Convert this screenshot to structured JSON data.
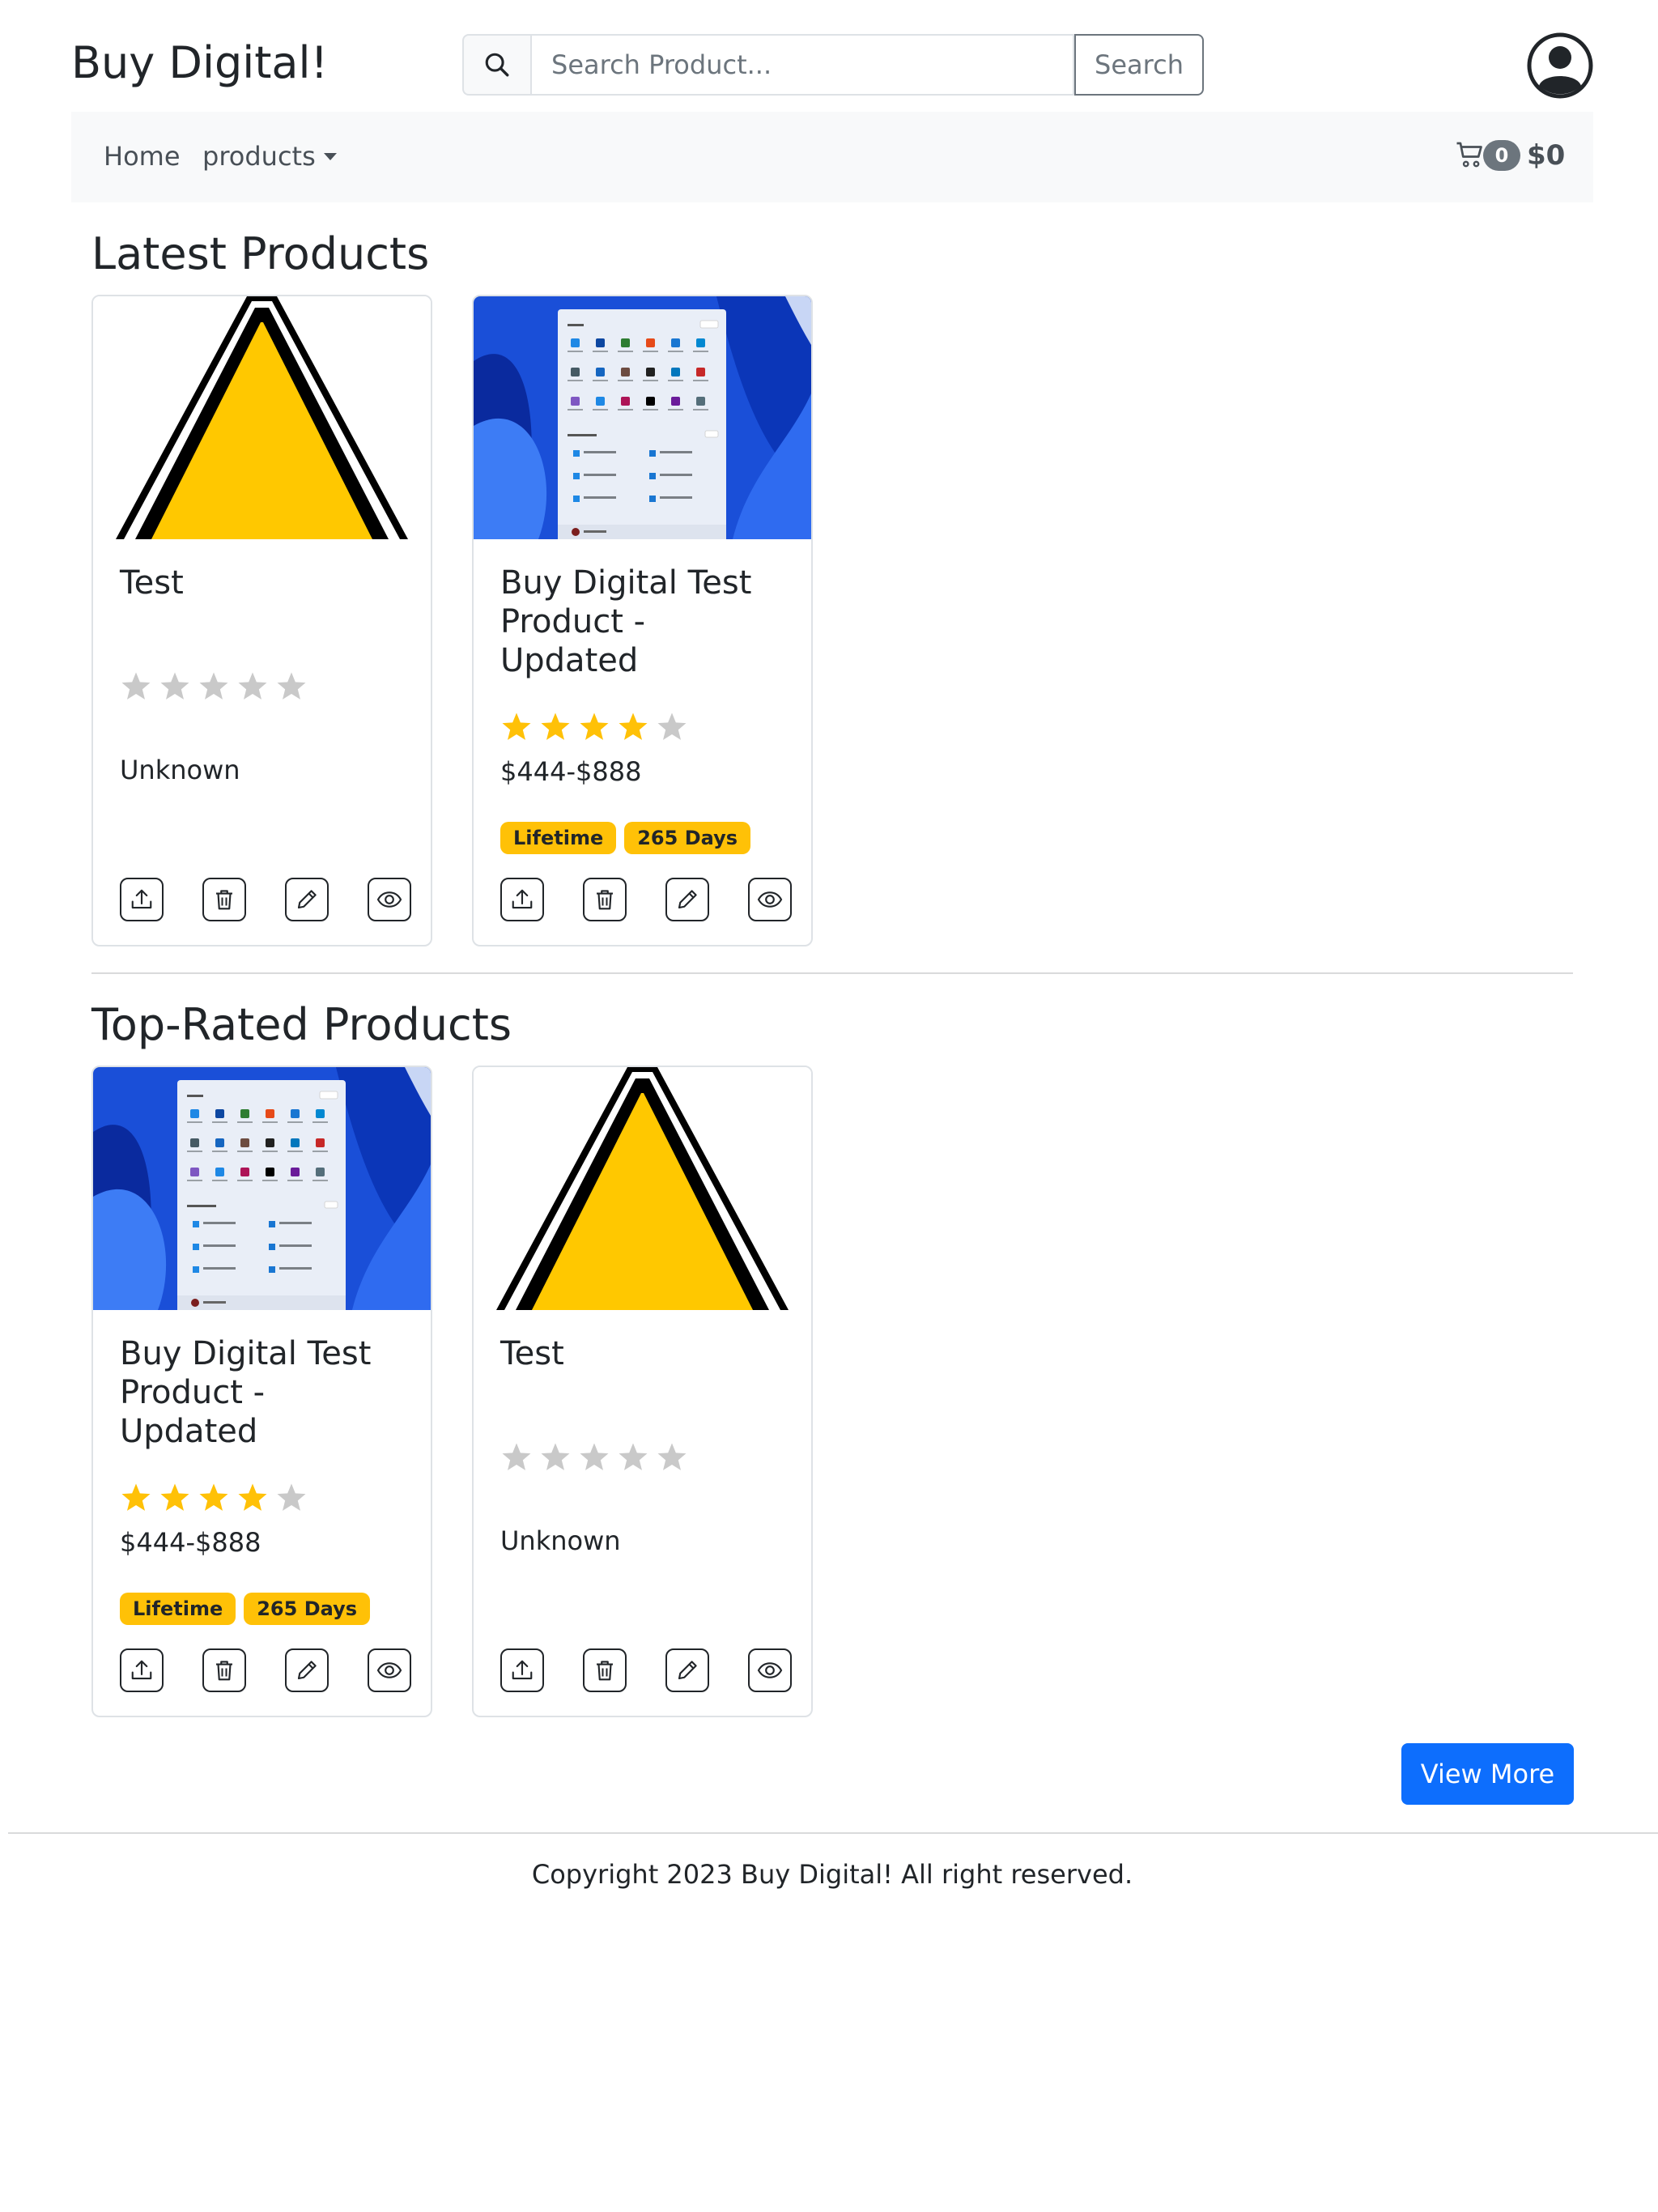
{
  "header": {
    "brand": "Buy Digital!",
    "search": {
      "placeholder": "Search Product...",
      "button_label": "Search"
    }
  },
  "navbar": {
    "home_label": "Home",
    "products_label": "products",
    "cart": {
      "count": "0",
      "total": "$0"
    }
  },
  "sections": [
    {
      "title": "Latest Products",
      "cards": [
        {
          "title": "Test",
          "image": "warning-triangle",
          "rating": 0,
          "price": "Unknown",
          "badges": []
        },
        {
          "title": "Buy Digital Test Product - Updated",
          "image": "windows-start-menu",
          "rating": 4,
          "price": "$444-$888",
          "badges": [
            "Lifetime",
            "265 Days"
          ]
        }
      ]
    },
    {
      "title": "Top-Rated Products",
      "cards": [
        {
          "title": "Buy Digital Test Product - Updated",
          "image": "windows-start-menu",
          "rating": 4,
          "price": "$444-$888",
          "badges": [
            "Lifetime",
            "265 Days"
          ]
        },
        {
          "title": "Test",
          "image": "warning-triangle",
          "rating": 0,
          "price": "Unknown",
          "badges": []
        }
      ]
    }
  ],
  "card_actions": [
    "upload-icon",
    "trash-icon",
    "pencil-icon",
    "eye-icon"
  ],
  "colors": {
    "star_filled": "#ffc107",
    "star_empty": "#c9c9c9",
    "badge": "#ffc107",
    "primary": "#0d6efd"
  },
  "view_more_label": "View More",
  "footer": {
    "copyright": "Copyright 2023 Buy Digital! All right reserved."
  }
}
